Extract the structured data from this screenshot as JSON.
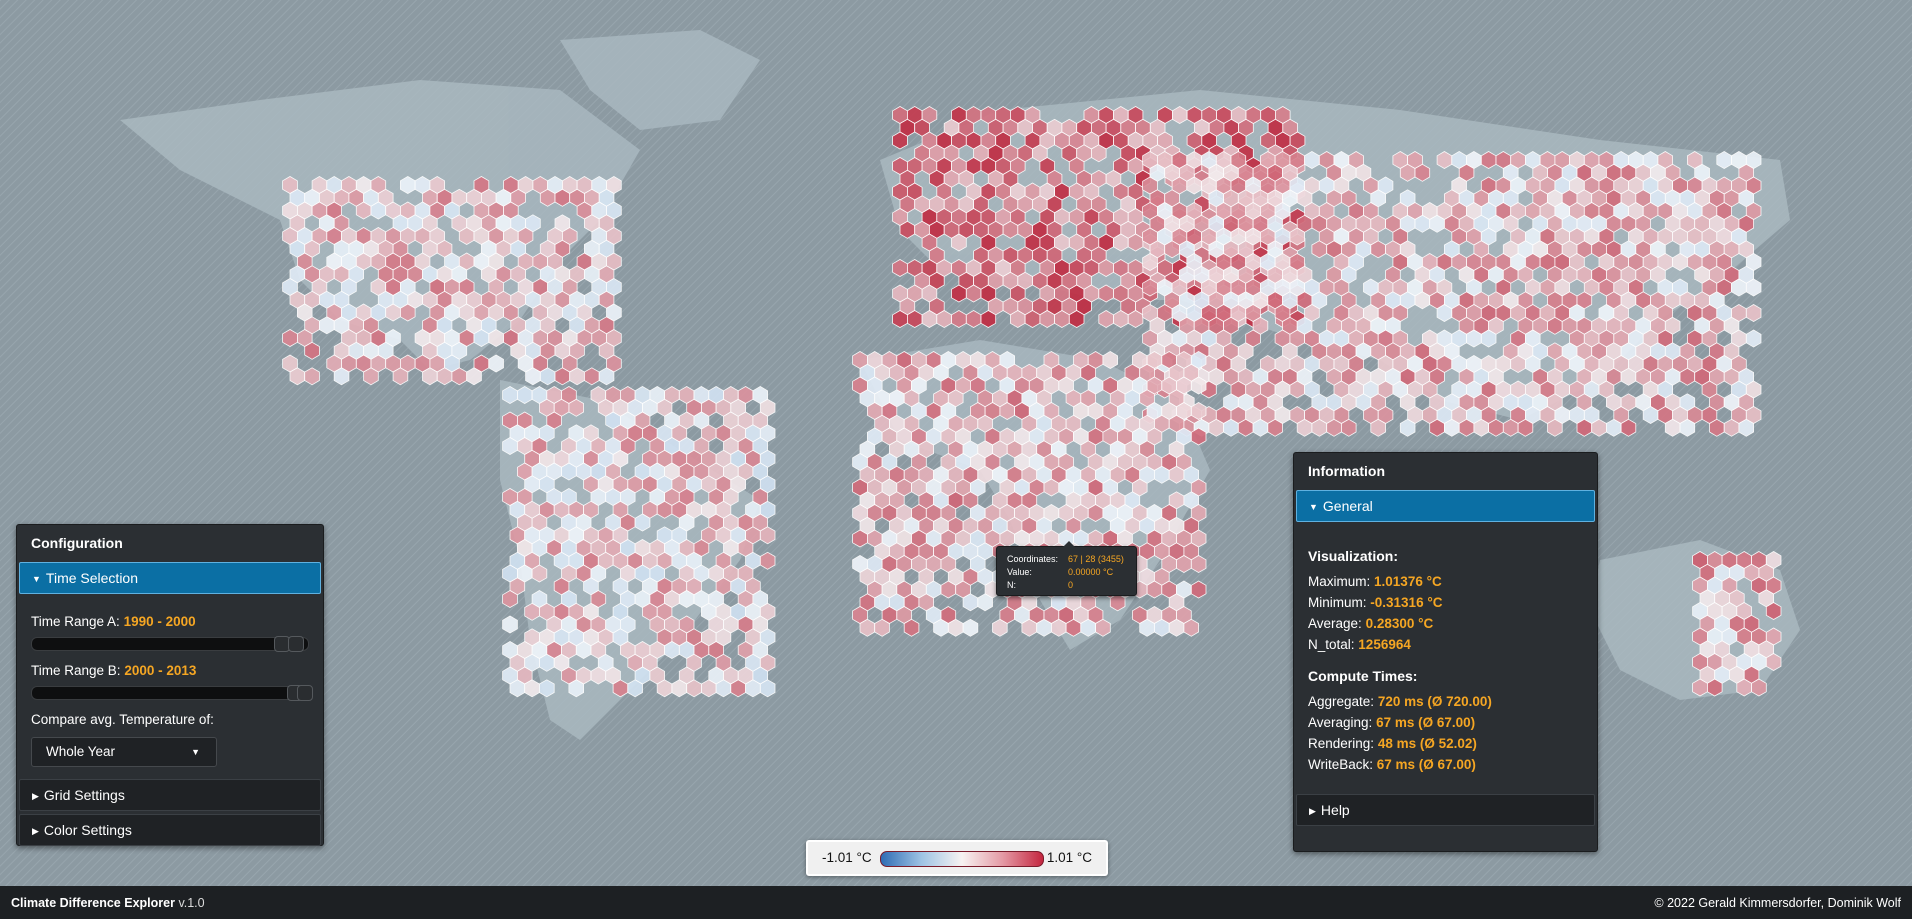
{
  "app": {
    "name": "Climate Difference Explorer",
    "version": "v.1.0",
    "copyright": "© 2022 Gerald Kimmersdorfer, Dominik Wolf"
  },
  "config": {
    "title": "Configuration",
    "time_selection_label": "Time Selection",
    "range_a": {
      "label": "Time Range A:",
      "value": "1990 - 2000"
    },
    "range_b": {
      "label": "Time Range B:",
      "value": "2000 - 2013"
    },
    "compare_label": "Compare avg. Temperature of:",
    "compare_value": "Whole Year",
    "grid_settings_label": "Grid Settings",
    "color_settings_label": "Color Settings"
  },
  "info": {
    "title": "Information",
    "general_label": "General",
    "visualization": {
      "heading": "Visualization:",
      "maximum_label": "Maximum:",
      "maximum_value": "1.01376 °C",
      "minimum_label": "Minimum:",
      "minimum_value": "-0.31316 °C",
      "average_label": "Average:",
      "average_value": "0.28300 °C",
      "ntotal_label": "N_total:",
      "ntotal_value": "1256964"
    },
    "compute": {
      "heading": "Compute Times:",
      "aggregate_label": "Aggregate:",
      "aggregate_value": "720 ms (Ø 720.00)",
      "averaging_label": "Averaging:",
      "averaging_value": "67 ms (Ø 67.00)",
      "rendering_label": "Rendering:",
      "rendering_value": "48 ms (Ø 52.02)",
      "writeback_label": "WriteBack:",
      "writeback_value": "67 ms (Ø 67.00)"
    },
    "help_label": "Help"
  },
  "legend": {
    "min": "-1.01 °C",
    "max": "1.01 °C"
  },
  "tooltip": {
    "coords_label": "Coordinates:",
    "coords_value": "67 | 28 (3455)",
    "value_label": "Value:",
    "value_value": "0.00000 °C",
    "n_label": "N:",
    "n_value": "0"
  },
  "colors": {
    "accent": "#f5a623",
    "active_section": "#0b6fa4",
    "warm": "#c4263f",
    "cool": "#2f6cb4"
  }
}
